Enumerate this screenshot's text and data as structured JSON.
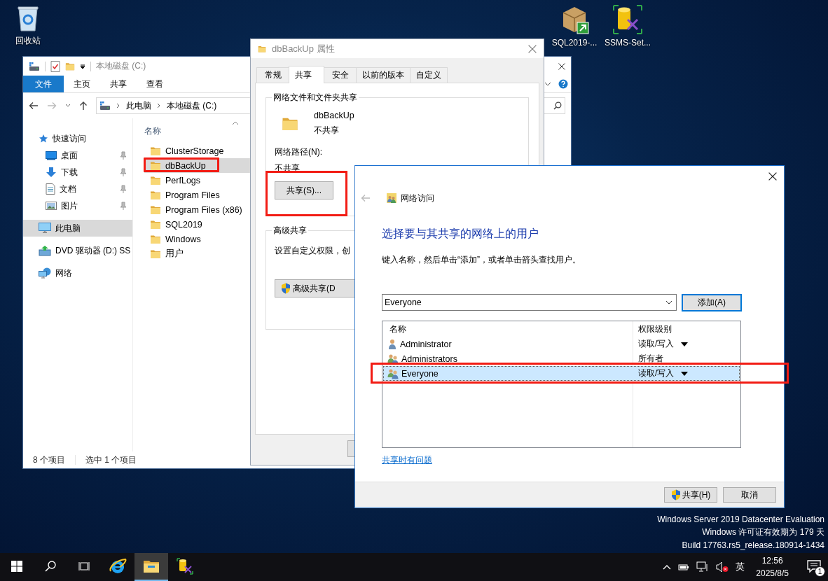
{
  "desktop_icons": [
    {
      "label": "回收站",
      "kind": "recycle-bin"
    },
    {
      "label": "SQL2019-...",
      "kind": "installer"
    },
    {
      "label": "SSMS-Set...",
      "kind": "setup"
    }
  ],
  "explorer": {
    "title": "本地磁盘 (C:)",
    "ribbon_tabs": [
      {
        "label": "文件",
        "selected": true
      },
      {
        "label": "主页",
        "selected": false
      },
      {
        "label": "共享",
        "selected": false
      },
      {
        "label": "查看",
        "selected": false
      }
    ],
    "breadcrumb": [
      "此电脑",
      "本地磁盘 (C:)"
    ],
    "nav": [
      {
        "label": "快速访问",
        "kind": "star",
        "selected": false,
        "children": [
          {
            "label": "桌面",
            "kind": "desktop",
            "pinned": true,
            "selected": false
          },
          {
            "label": "下载",
            "kind": "download",
            "pinned": true,
            "selected": false
          },
          {
            "label": "文档",
            "kind": "documents",
            "pinned": true,
            "selected": false
          },
          {
            "label": "图片",
            "kind": "pictures",
            "pinned": true,
            "selected": false
          }
        ]
      },
      {
        "label": "此电脑",
        "kind": "pc",
        "selected": true
      },
      {
        "label": "DVD 驱动器 (D:) SS",
        "kind": "dvd",
        "selected": false
      },
      {
        "label": "网络",
        "kind": "network",
        "selected": false
      }
    ],
    "column": "名称",
    "files": [
      {
        "name": "ClusterStorage",
        "selected": false,
        "highlighted": false
      },
      {
        "name": "dbBackUp",
        "selected": true,
        "highlighted": true
      },
      {
        "name": "PerfLogs",
        "selected": false,
        "highlighted": false
      },
      {
        "name": "Program Files",
        "selected": false,
        "highlighted": false
      },
      {
        "name": "Program Files (x86)",
        "selected": false,
        "highlighted": false
      },
      {
        "name": "SQL2019",
        "selected": false,
        "highlighted": false
      },
      {
        "name": "Windows",
        "selected": false,
        "highlighted": false
      },
      {
        "name": "用户",
        "selected": false,
        "highlighted": false
      }
    ],
    "status": [
      "8 个项目",
      "选中 1 个项目"
    ]
  },
  "properties": {
    "title": "dbBackUp 属性",
    "tabs": [
      {
        "label": "常规",
        "selected": false
      },
      {
        "label": "共享",
        "selected": true
      },
      {
        "label": "安全",
        "selected": false
      },
      {
        "label": "以前的版本",
        "selected": false
      },
      {
        "label": "自定义",
        "selected": false
      }
    ],
    "sharing_group": {
      "title": "网络文件和文件夹共享",
      "folder_name": "dbBackUp",
      "folder_state": "不共享",
      "path_label": "网络路径(N):",
      "path_value": "不共享",
      "share_button": {
        "label": "共享(S)...",
        "highlighted": true
      }
    },
    "advanced_group": {
      "title": "高级共享",
      "description": "设置自定义权限，创",
      "button": "高级共享(D"
    }
  },
  "network_access": {
    "title": "网络访问",
    "heading": "选择要与其共享的网络上的用户",
    "instruction": "键入名称，然后单击“添加”，或者单击箭头查找用户。",
    "name_field": {
      "value": "Everyone"
    },
    "add_button": "添加(A)",
    "columns": [
      "名称",
      "权限级别"
    ],
    "users": [
      {
        "name": "Administrator",
        "kind": "user",
        "permission": "读取/写入",
        "has_menu": true,
        "selected": false,
        "highlighted": false
      },
      {
        "name": "Administrators",
        "kind": "group",
        "permission": "所有者",
        "has_menu": false,
        "selected": false,
        "highlighted": false
      },
      {
        "name": "Everyone",
        "kind": "group",
        "permission": "读取/写入",
        "has_menu": true,
        "selected": true,
        "highlighted": true
      }
    ],
    "help_link": "共享时有问题",
    "buttons": [
      {
        "label": "共享(H)",
        "kind": "shield"
      },
      {
        "label": "取消",
        "kind": "plain"
      }
    ]
  },
  "os_info": [
    "Windows Server 2019 Datacenter Evaluation",
    "Windows 许可证有效期为 179 天",
    "Build 17763.rs5_release.180914-1434"
  ],
  "taskbar": {
    "apps": [
      {
        "kind": "ie",
        "active": false
      },
      {
        "kind": "explorer",
        "active": true
      },
      {
        "kind": "ssms",
        "active": false
      }
    ],
    "ime": "英",
    "time": "12:56",
    "date": "2025/8/5",
    "notifications": "1"
  }
}
